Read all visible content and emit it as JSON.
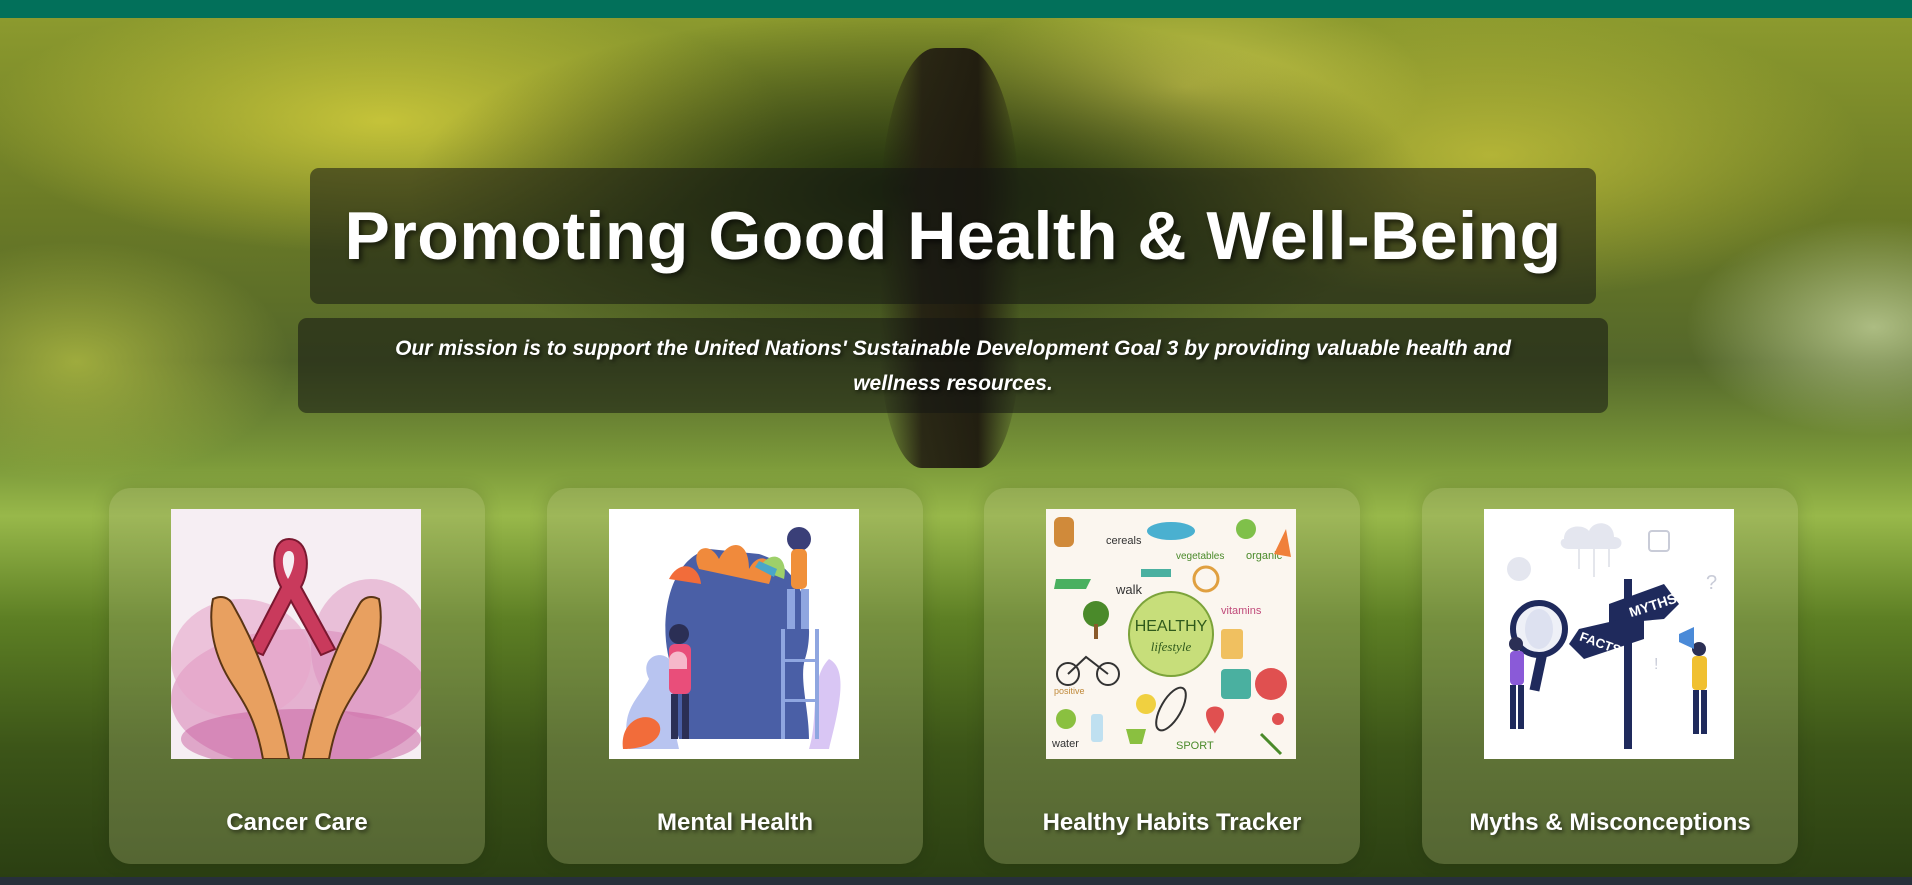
{
  "hero": {
    "title": "Promoting Good Health & Well-Being",
    "mission": "Our mission is to support the United Nations' Sustainable Development Goal 3 by providing valuable health and wellness resources."
  },
  "cards": [
    {
      "label": "Cancer Care",
      "icon": "ribbon-hands-icon"
    },
    {
      "label": "Mental Health",
      "icon": "head-garden-icon"
    },
    {
      "label": "Healthy Habits Tracker",
      "icon": "healthy-lifestyle-icon"
    },
    {
      "label": "Myths & Misconceptions",
      "icon": "myths-facts-signpost-icon"
    }
  ],
  "illustration_text": {
    "healthy": "HEALTHY",
    "lifestyle": "lifestyle",
    "walk": "walk",
    "cereals": "cereals",
    "vegetables": "vegetables",
    "organic": "organic",
    "vitamins": "vitamins",
    "positive": "positive",
    "sport": "SPORT",
    "water": "water",
    "myths": "MYTHS",
    "facts": "FACTS"
  },
  "colors": {
    "topbar": "#02705a",
    "card_text": "#ffffff"
  }
}
